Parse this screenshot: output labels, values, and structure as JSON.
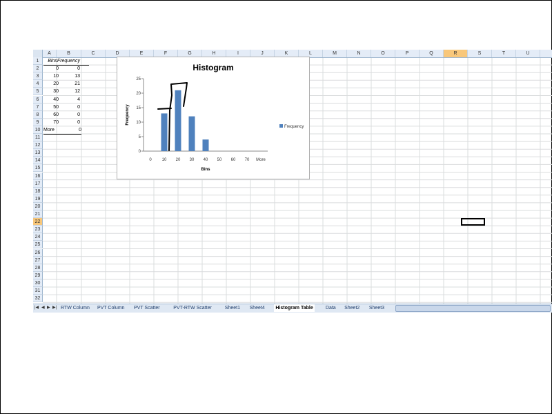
{
  "columns": [
    "A",
    "B",
    "C",
    "D",
    "E",
    "F",
    "G",
    "H",
    "I",
    "J",
    "K",
    "L",
    "M",
    "N",
    "O",
    "P",
    "Q",
    "R",
    "S",
    "T",
    "U"
  ],
  "selected_column": "R",
  "rows": [
    "1",
    "2",
    "3",
    "4",
    "5",
    "6",
    "7",
    "8",
    "9",
    "10",
    "11",
    "12",
    "13",
    "14",
    "15",
    "16",
    "17",
    "18",
    "19",
    "20",
    "21",
    "22",
    "23",
    "24",
    "25",
    "26",
    "27",
    "28",
    "29",
    "30",
    "31",
    "32"
  ],
  "selected_row": "22",
  "table": {
    "headers": [
      "Bins",
      "Frequency"
    ],
    "rows": [
      {
        "bin": "0",
        "freq": "0"
      },
      {
        "bin": "10",
        "freq": "13"
      },
      {
        "bin": "20",
        "freq": "21"
      },
      {
        "bin": "30",
        "freq": "12"
      },
      {
        "bin": "40",
        "freq": "4"
      },
      {
        "bin": "50",
        "freq": "0"
      },
      {
        "bin": "60",
        "freq": "0"
      },
      {
        "bin": "70",
        "freq": "0"
      },
      {
        "bin": "More",
        "freq": "0"
      }
    ]
  },
  "tabs": [
    "RTW Column",
    "PVT Column",
    "PVT Scatter",
    "PVT-RTW Scatter",
    "Sheet1",
    "Sheet4",
    "Histogram Table",
    "Data",
    "Sheet2",
    "Sheet3"
  ],
  "active_tab": "Histogram Table",
  "colors": {
    "bar": "#4f81bd",
    "header_bg": "#e4ecf7",
    "selected_header": "#f8c77a"
  },
  "chart_data": {
    "type": "bar",
    "title": "Histogram",
    "xlabel": "Bins",
    "ylabel": "Frequency",
    "categories": [
      "0",
      "10",
      "20",
      "30",
      "40",
      "50",
      "60",
      "70",
      "More"
    ],
    "series": [
      {
        "name": "Frequency",
        "values": [
          0,
          13,
          21,
          12,
          4,
          0,
          0,
          0,
          0
        ]
      }
    ],
    "ylim": [
      0,
      25
    ],
    "yticks": [
      "0",
      "5",
      "10",
      "15",
      "20",
      "25"
    ],
    "legend": "right",
    "grid": false
  }
}
